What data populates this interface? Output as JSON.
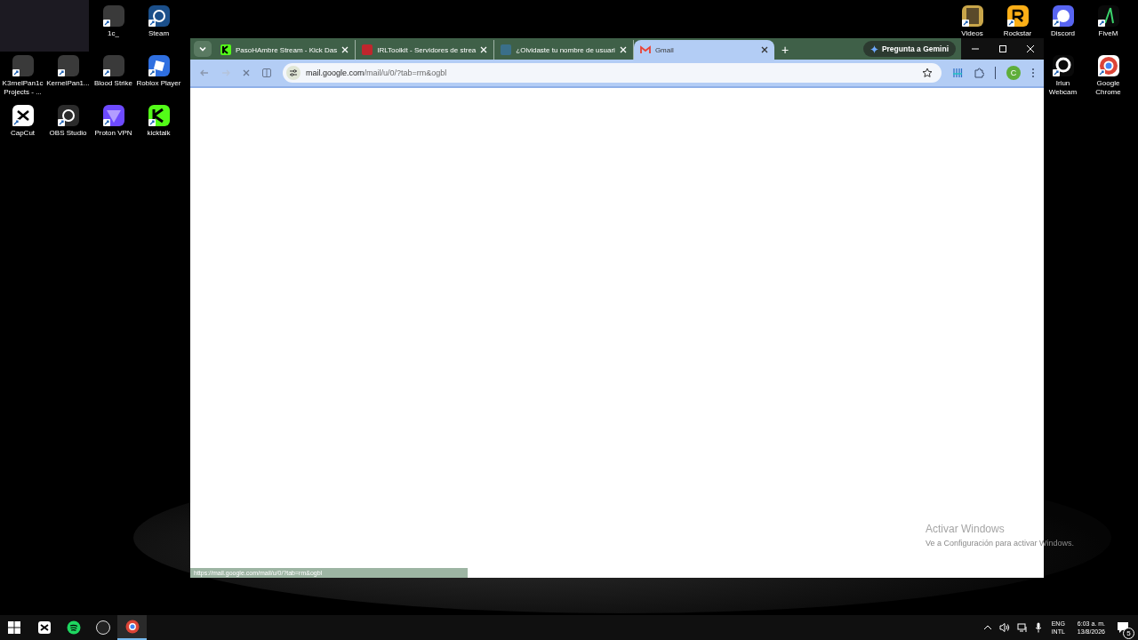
{
  "desktop": {
    "left_icons": [
      {
        "label": "1c_",
        "kind": "app"
      },
      {
        "label": "Steam",
        "kind": "steam"
      },
      {
        "label": "K3rnelPan1c Projects - ...",
        "kind": "app"
      },
      {
        "label": "KernelPan1...",
        "kind": "app"
      },
      {
        "label": "Blood Strike",
        "kind": "app"
      },
      {
        "label": "Roblox Player",
        "kind": "roblox"
      },
      {
        "label": "CapCut",
        "kind": "capcut"
      },
      {
        "label": "OBS Studio",
        "kind": "obs"
      },
      {
        "label": "Proton VPN",
        "kind": "proton"
      },
      {
        "label": "kicktalk",
        "kind": "kick"
      }
    ],
    "right_icons": [
      {
        "label": "Videos",
        "kind": "folder"
      },
      {
        "label": "Rockstar",
        "kind": "rockstar"
      },
      {
        "label": "Discord",
        "kind": "discord"
      },
      {
        "label": "FiveM",
        "kind": "fivem"
      },
      {
        "label": "Iriun Webcam",
        "kind": "iriun"
      },
      {
        "label": "Google Chrome",
        "kind": "chrome"
      }
    ],
    "watermark_title": "Activar Windows",
    "watermark_text": "Ve a Configuración para activar Windows."
  },
  "browser": {
    "tabs": [
      {
        "title": "PasoHAmbre Stream - Kick Das",
        "kind": "kick",
        "selected": false
      },
      {
        "title": "IRLToolkit - Servidores de strea",
        "kind": "irl",
        "selected": false
      },
      {
        "title": "¿Olvidaste tu nombre de usuari",
        "kind": "globe",
        "selected": false
      },
      {
        "title": "Gmail",
        "kind": "gmail",
        "selected": true
      }
    ],
    "new_tab": "+",
    "gemini_button": "Pregunta a Gemini",
    "url_host": "mail.google.com",
    "url_path": "/mail/u/0/?tab=rm&ogbl",
    "profile_initial": "C",
    "status_url": "https://mail.google.com/mail/u/0/?tab=rm&ogbl"
  },
  "taskbar": {
    "apps": [
      {
        "kind": "capcut",
        "active": false
      },
      {
        "kind": "spotify",
        "active": false
      },
      {
        "kind": "obs",
        "active": false
      },
      {
        "kind": "chrome",
        "active": true
      }
    ],
    "language": "ENG",
    "layout": "INTL",
    "time": "6:03 a. m.",
    "date": "13/8/2026",
    "notifications": "5"
  }
}
